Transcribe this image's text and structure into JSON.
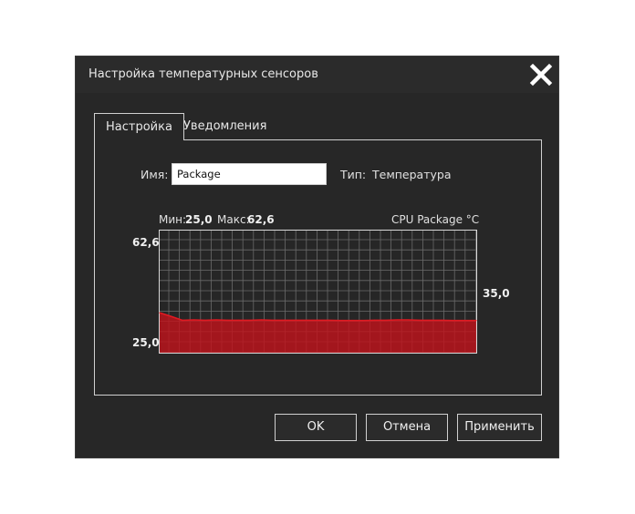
{
  "dialog": {
    "title": "Настройка температурных сенсоров",
    "close_icon": "close-x-icon"
  },
  "tabs": [
    {
      "label": "Настройка",
      "active": true
    },
    {
      "label": "Уведомления",
      "active": false
    }
  ],
  "form": {
    "name_label": "Имя:",
    "name_value": "Package",
    "type_label": "Тип:",
    "type_value": "Температура"
  },
  "graph": {
    "min_label": "Мин:",
    "min_value": "25,0",
    "max_label": "Макс:",
    "max_value": "62,6",
    "sensor_label": "CPU  Package  °C",
    "y_top_label": "62,6",
    "y_bottom_label": "25,0",
    "current_value_label": "35,0",
    "accent_color": "#c0141c",
    "grid_color": "#6a6a6a",
    "ylim": [
      25.0,
      62.6
    ],
    "values": [
      37.3,
      36.2,
      35.0,
      35.1,
      35.0,
      35.1,
      35.0,
      35.0,
      35.0,
      35.1,
      35.0,
      35.0,
      35.0,
      35.0,
      35.0,
      35.0,
      34.9,
      34.9,
      34.9,
      35.0,
      35.0,
      35.1,
      35.1,
      35.0,
      35.0,
      35.0,
      34.9,
      34.9,
      34.9
    ]
  },
  "buttons": {
    "ok": "OK",
    "cancel": "Отмена",
    "apply": "Применить"
  }
}
